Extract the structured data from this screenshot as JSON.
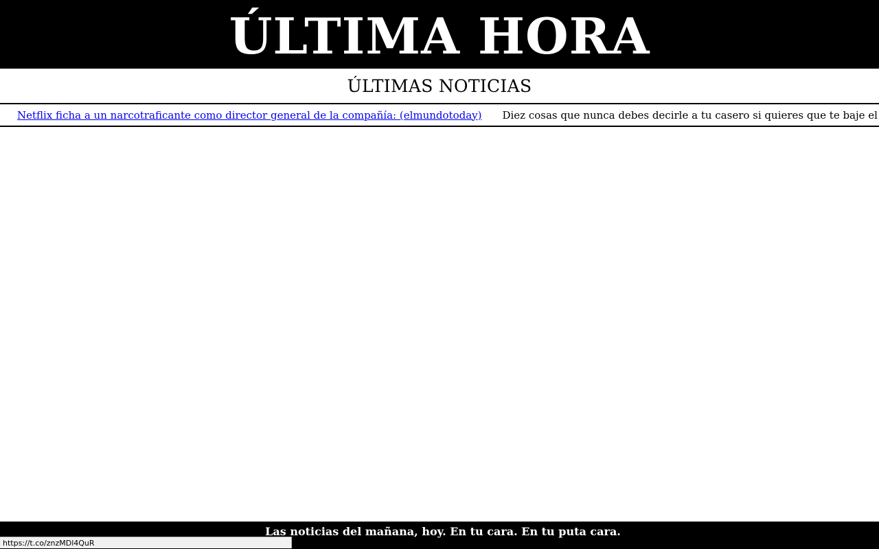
{
  "masthead": {
    "title": "ÚLTIMA HORA"
  },
  "section": {
    "title": "ÚLTIMAS NOTICIAS"
  },
  "ticker": {
    "items": [
      {
        "text": "Netflix ficha a un narcotraficante como director general de la compañía: (elmundotoday)",
        "is_link": true
      },
      {
        "text": "Diez cosas que nunca debes decirle a tu casero si quieres que te baje el alquiler: (",
        "is_link": false
      }
    ]
  },
  "footer": {
    "tagline": "Las noticias del mañana, hoy. En tu cara. En tu puta cara."
  },
  "status_bar": {
    "url": "https://t.co/znzMDl4QuR"
  },
  "colors": {
    "background": "#ffffff",
    "masthead_bg": "#000000",
    "masthead_text": "#ffffff",
    "link": "#0000ee",
    "footer_bg": "#000000"
  }
}
